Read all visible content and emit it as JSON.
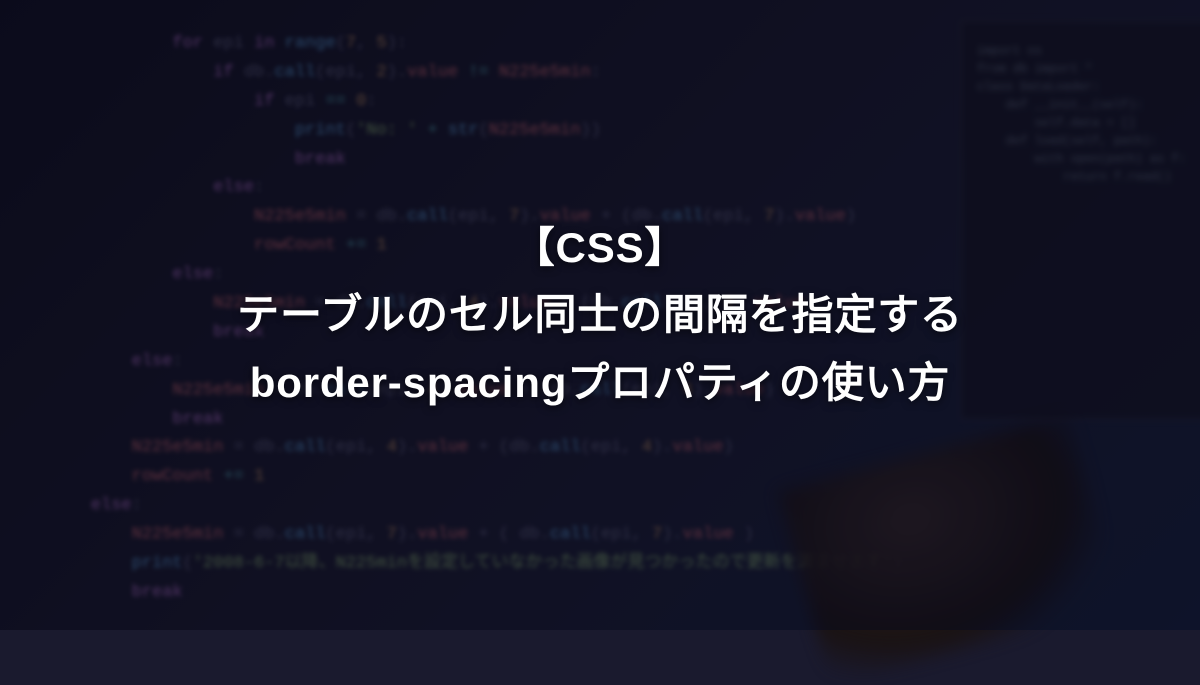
{
  "title": {
    "line1": "【CSS】",
    "line2": "テーブルのセル同士の間隔を指定する",
    "line3": "border-spacingプロパティの使い方"
  },
  "code_lines": [
    {
      "indent": 3,
      "segments": [
        {
          "t": "for",
          "c": "kw"
        },
        {
          "t": " epi ",
          "c": ""
        },
        {
          "t": "in",
          "c": "kw"
        },
        {
          "t": " ",
          "c": ""
        },
        {
          "t": "range",
          "c": "fn"
        },
        {
          "t": "(",
          "c": ""
        },
        {
          "t": "7",
          "c": "num"
        },
        {
          "t": ", ",
          "c": ""
        },
        {
          "t": "5",
          "c": "num"
        },
        {
          "t": "):",
          "c": ""
        }
      ]
    },
    {
      "indent": 4,
      "segments": [
        {
          "t": "if",
          "c": "kw"
        },
        {
          "t": " db.",
          "c": ""
        },
        {
          "t": "call",
          "c": "fn"
        },
        {
          "t": "(epi, ",
          "c": ""
        },
        {
          "t": "2",
          "c": "num"
        },
        {
          "t": ").",
          "c": ""
        },
        {
          "t": "value",
          "c": "var"
        },
        {
          "t": " != ",
          "c": "op"
        },
        {
          "t": "N225e5min",
          "c": "var"
        },
        {
          "t": ":",
          "c": ""
        }
      ]
    },
    {
      "indent": 5,
      "segments": [
        {
          "t": "if",
          "c": "kw"
        },
        {
          "t": " epi ",
          "c": ""
        },
        {
          "t": "==",
          "c": "op"
        },
        {
          "t": " ",
          "c": ""
        },
        {
          "t": "0",
          "c": "num"
        },
        {
          "t": ":",
          "c": ""
        }
      ]
    },
    {
      "indent": 6,
      "segments": [
        {
          "t": "print",
          "c": "fn"
        },
        {
          "t": "(",
          "c": ""
        },
        {
          "t": "'No: '",
          "c": "str"
        },
        {
          "t": " + ",
          "c": "op"
        },
        {
          "t": "str",
          "c": "fn"
        },
        {
          "t": "(",
          "c": ""
        },
        {
          "t": "N225e5min",
          "c": "var"
        },
        {
          "t": "))",
          "c": ""
        }
      ]
    },
    {
      "indent": 6,
      "segments": [
        {
          "t": "break",
          "c": "kw"
        }
      ]
    },
    {
      "indent": 4,
      "segments": [
        {
          "t": "else",
          "c": "kw"
        },
        {
          "t": ":",
          "c": ""
        }
      ]
    },
    {
      "indent": 5,
      "segments": [
        {
          "t": "N225e5min",
          "c": "var"
        },
        {
          "t": " = db.",
          "c": ""
        },
        {
          "t": "call",
          "c": "fn"
        },
        {
          "t": "(epi, ",
          "c": ""
        },
        {
          "t": "7",
          "c": "num"
        },
        {
          "t": ").",
          "c": ""
        },
        {
          "t": "value",
          "c": "var"
        },
        {
          "t": " + (db.",
          "c": ""
        },
        {
          "t": "call",
          "c": "fn"
        },
        {
          "t": "(epi, ",
          "c": ""
        },
        {
          "t": "7",
          "c": "num"
        },
        {
          "t": ").",
          "c": ""
        },
        {
          "t": "value",
          "c": "var"
        },
        {
          "t": ")",
          "c": ""
        }
      ]
    },
    {
      "indent": 5,
      "segments": [
        {
          "t": "rowCount",
          "c": "var"
        },
        {
          "t": " += ",
          "c": "op"
        },
        {
          "t": "1",
          "c": "num"
        }
      ]
    },
    {
      "indent": 0,
      "segments": [
        {
          "t": "",
          "c": ""
        }
      ]
    },
    {
      "indent": 3,
      "segments": [
        {
          "t": "else",
          "c": "kw"
        },
        {
          "t": ":",
          "c": ""
        }
      ]
    },
    {
      "indent": 4,
      "segments": [
        {
          "t": "N225e5min",
          "c": "var"
        },
        {
          "t": " = db.",
          "c": ""
        },
        {
          "t": "call",
          "c": "fn"
        },
        {
          "t": "(epi, ",
          "c": ""
        },
        {
          "t": "4",
          "c": "num"
        },
        {
          "t": ").",
          "c": ""
        },
        {
          "t": "value",
          "c": "var"
        },
        {
          "t": " + (db.",
          "c": ""
        },
        {
          "t": "call",
          "c": "fn"
        },
        {
          "t": "(epi, ",
          "c": ""
        },
        {
          "t": "4",
          "c": "num"
        },
        {
          "t": ").",
          "c": ""
        },
        {
          "t": "value",
          "c": "var"
        },
        {
          "t": ")",
          "c": ""
        }
      ]
    },
    {
      "indent": 4,
      "segments": [
        {
          "t": "break",
          "c": "kw"
        }
      ]
    },
    {
      "indent": 0,
      "segments": [
        {
          "t": "",
          "c": ""
        }
      ]
    },
    {
      "indent": 0,
      "segments": [
        {
          "t": "",
          "c": ""
        }
      ]
    },
    {
      "indent": 0,
      "segments": [
        {
          "t": "",
          "c": ""
        }
      ]
    },
    {
      "indent": 0,
      "segments": [
        {
          "t": "",
          "c": ""
        }
      ]
    },
    {
      "indent": 2,
      "segments": [
        {
          "t": "else",
          "c": "kw"
        },
        {
          "t": ":",
          "c": ""
        }
      ]
    },
    {
      "indent": 3,
      "segments": [
        {
          "t": "N225e5min",
          "c": "var"
        },
        {
          "t": " = db.",
          "c": ""
        },
        {
          "t": "call",
          "c": "fn"
        },
        {
          "t": "(epi, ",
          "c": ""
        },
        {
          "t": "4",
          "c": "num"
        },
        {
          "t": ").",
          "c": ""
        },
        {
          "t": "value",
          "c": "var"
        },
        {
          "t": " + (db.",
          "c": ""
        },
        {
          "t": "call",
          "c": "fn"
        },
        {
          "t": "(epi, ",
          "c": ""
        },
        {
          "t": "4",
          "c": "num"
        },
        {
          "t": ").",
          "c": ""
        },
        {
          "t": "value",
          "c": "var"
        },
        {
          "t": ")",
          "c": ""
        }
      ]
    },
    {
      "indent": 3,
      "segments": [
        {
          "t": "break",
          "c": "kw"
        }
      ]
    },
    {
      "indent": 0,
      "segments": [
        {
          "t": "",
          "c": ""
        }
      ]
    },
    {
      "indent": 0,
      "segments": [
        {
          "t": "",
          "c": ""
        }
      ]
    },
    {
      "indent": 2,
      "segments": [
        {
          "t": "N225e5min",
          "c": "var"
        },
        {
          "t": " = db.",
          "c": ""
        },
        {
          "t": "call",
          "c": "fn"
        },
        {
          "t": "(epi, ",
          "c": ""
        },
        {
          "t": "4",
          "c": "num"
        },
        {
          "t": ").",
          "c": ""
        },
        {
          "t": "value",
          "c": "var"
        },
        {
          "t": " + (db.",
          "c": ""
        },
        {
          "t": "call",
          "c": "fn"
        },
        {
          "t": "(epi, ",
          "c": ""
        },
        {
          "t": "4",
          "c": "num"
        },
        {
          "t": ").",
          "c": ""
        },
        {
          "t": "value",
          "c": "var"
        },
        {
          "t": ")",
          "c": ""
        }
      ]
    },
    {
      "indent": 2,
      "segments": [
        {
          "t": "rowCount",
          "c": "var"
        },
        {
          "t": " += ",
          "c": "op"
        },
        {
          "t": "1",
          "c": "num"
        }
      ]
    },
    {
      "indent": 0,
      "segments": [
        {
          "t": "",
          "c": ""
        }
      ]
    },
    {
      "indent": 1,
      "segments": [
        {
          "t": "else",
          "c": "kw"
        },
        {
          "t": ":",
          "c": ""
        }
      ]
    },
    {
      "indent": 2,
      "segments": [
        {
          "t": "N225e5min",
          "c": "var"
        },
        {
          "t": " = db.",
          "c": ""
        },
        {
          "t": "call",
          "c": "fn"
        },
        {
          "t": "(epi, ",
          "c": ""
        },
        {
          "t": "7",
          "c": "num"
        },
        {
          "t": ").",
          "c": ""
        },
        {
          "t": "value",
          "c": "var"
        },
        {
          "t": " + ( db.",
          "c": ""
        },
        {
          "t": "call",
          "c": "fn"
        },
        {
          "t": "(epi, ",
          "c": ""
        },
        {
          "t": "7",
          "c": "num"
        },
        {
          "t": ").",
          "c": ""
        },
        {
          "t": "value",
          "c": "var"
        },
        {
          "t": " )",
          "c": ""
        }
      ]
    },
    {
      "indent": 0,
      "segments": [
        {
          "t": "",
          "c": ""
        }
      ]
    },
    {
      "indent": 2,
      "segments": [
        {
          "t": "print",
          "c": "fn"
        },
        {
          "t": "(",
          "c": ""
        },
        {
          "t": "'2008-6-7以降、N225minを設定していなかった画像が見つかったので更新を済ませます'",
          "c": "str"
        },
        {
          "t": ")",
          "c": ""
        }
      ]
    },
    {
      "indent": 2,
      "segments": [
        {
          "t": "break",
          "c": "kw"
        }
      ]
    }
  ],
  "right_monitor_lines": [
    "import os",
    "from db import *",
    "",
    "class DataLoader:",
    "    def __init__(self):",
    "        self.data = []",
    "",
    "    def load(self, path):",
    "        with open(path) as f:",
    "            return f.read()"
  ]
}
